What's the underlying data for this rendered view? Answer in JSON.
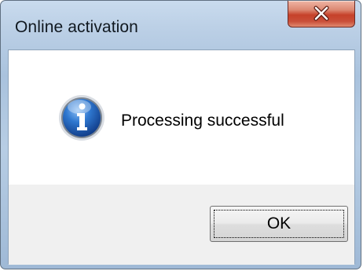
{
  "window": {
    "title": "Online activation",
    "close_icon": "close-icon"
  },
  "message": {
    "icon": "info-icon",
    "text": "Processing successful"
  },
  "buttons": {
    "ok_label": "OK"
  },
  "colors": {
    "title_bar": "#b7cde4",
    "close_button": "#c6412a",
    "info_icon": "#1d5fb8",
    "button_area": "#f0f0f0"
  }
}
